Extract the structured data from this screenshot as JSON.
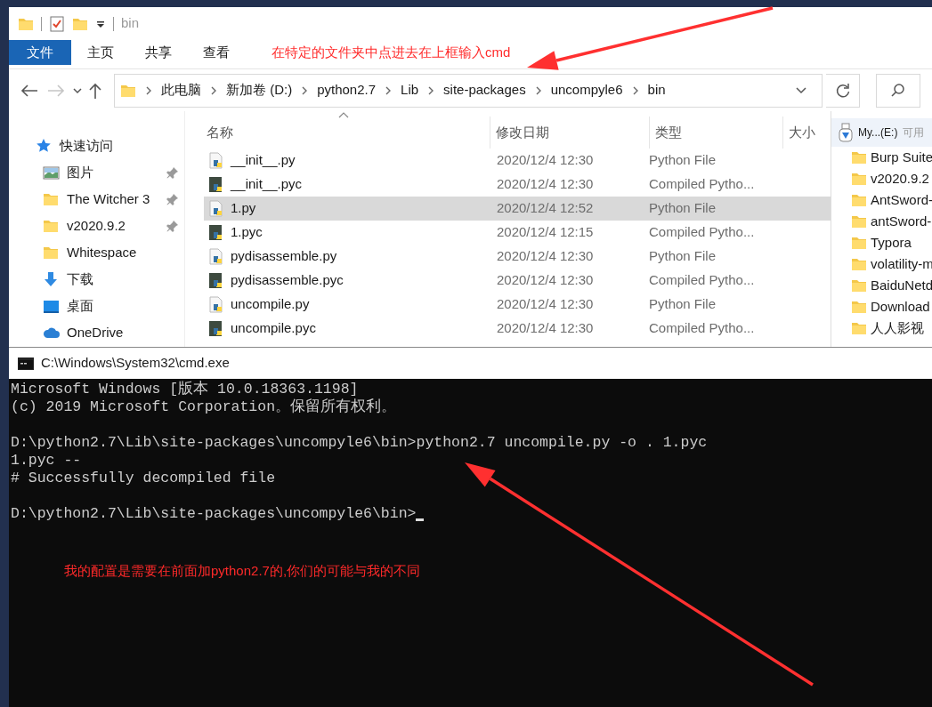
{
  "explorer": {
    "title": "bin",
    "ribbon_tabs": [
      {
        "label": "文件",
        "selected": true
      },
      {
        "label": "主页",
        "selected": false
      },
      {
        "label": "共享",
        "selected": false
      },
      {
        "label": "查看",
        "selected": false
      }
    ],
    "annotation": "在特定的文件夹中点进去在上框输入cmd",
    "breadcrumb": [
      "此电脑",
      "新加卷 (D:)",
      "python2.7",
      "Lib",
      "site-packages",
      "uncompyle6",
      "bin"
    ],
    "nav_items": [
      {
        "label": "快速访问",
        "kind": "star",
        "pinned": false
      },
      {
        "label": "图片",
        "kind": "pictures",
        "pinned": true
      },
      {
        "label": "The Witcher 3",
        "kind": "folder",
        "pinned": true
      },
      {
        "label": "v2020.9.2",
        "kind": "folder",
        "pinned": true
      },
      {
        "label": "Whitespace",
        "kind": "folder",
        "pinned": false
      },
      {
        "label": "下载",
        "kind": "download",
        "pinned": false
      },
      {
        "label": "桌面",
        "kind": "desktop",
        "pinned": false
      },
      {
        "label": "OneDrive",
        "kind": "cloud",
        "pinned": false
      }
    ],
    "columns": [
      "名称",
      "修改日期",
      "类型",
      "大小"
    ],
    "files": [
      {
        "name": "__init__.py",
        "modified": "2020/12/4 12:30",
        "type": "Python File",
        "kind": "py",
        "selected": false
      },
      {
        "name": "__init__.pyc",
        "modified": "2020/12/4 12:30",
        "type": "Compiled Pytho...",
        "kind": "pyc",
        "selected": false
      },
      {
        "name": "1.py",
        "modified": "2020/12/4 12:52",
        "type": "Python File",
        "kind": "py",
        "selected": true
      },
      {
        "name": "1.pyc",
        "modified": "2020/12/4 12:15",
        "type": "Compiled Pytho...",
        "kind": "pyc",
        "selected": false
      },
      {
        "name": "pydisassemble.py",
        "modified": "2020/12/4 12:30",
        "type": "Python File",
        "kind": "py",
        "selected": false
      },
      {
        "name": "pydisassemble.pyc",
        "modified": "2020/12/4 12:30",
        "type": "Compiled Pytho...",
        "kind": "pyc",
        "selected": false
      },
      {
        "name": "uncompile.py",
        "modified": "2020/12/4 12:30",
        "type": "Python File",
        "kind": "py",
        "selected": false
      },
      {
        "name": "uncompile.pyc",
        "modified": "2020/12/4 12:30",
        "type": "Compiled Pytho...",
        "kind": "pyc",
        "selected": false
      }
    ],
    "side_panel": {
      "drive": "My...(E:)",
      "drive_note": "可用",
      "folders": [
        "Burp Suite",
        "v2020.9.2",
        "AntSword-",
        "antSword-",
        "Typora",
        "volatility-m",
        "BaiduNetd",
        "Download",
        "人人影视"
      ]
    }
  },
  "cmd": {
    "title": "C:\\Windows\\System32\\cmd.exe",
    "blocks": [
      [
        "Microsoft Windows [版本 10.0.18363.1198]",
        "(c) 2019 Microsoft Corporation。保留所有权利。"
      ],
      [
        "D:\\python2.7\\Lib\\site-packages\\uncompyle6\\bin>python2.7 uncompile.py -o . 1.pyc",
        "1.pyc --",
        "# Successfully decompiled file"
      ]
    ],
    "prompt": "D:\\python2.7\\Lib\\site-packages\\uncompyle6\\bin>",
    "cursor": true,
    "annotation": "我的配置是需要在前面加python2.7的,你们的可能与我的不同"
  }
}
